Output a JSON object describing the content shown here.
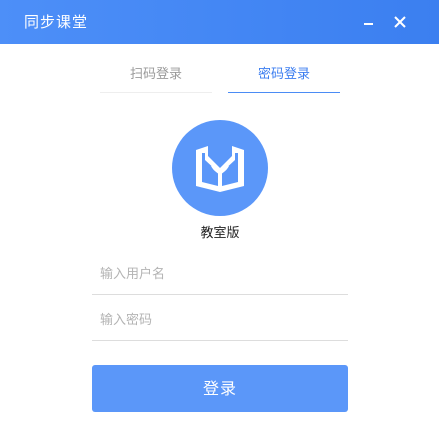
{
  "window": {
    "title": "同步课堂",
    "accent_color": "#3b7ff0",
    "controls": {
      "minimize_icon": "minimize-icon",
      "close_icon": "close-icon"
    }
  },
  "tabs": [
    {
      "label": "扫码登录",
      "active": false
    },
    {
      "label": "密码登录",
      "active": true
    }
  ],
  "logo": {
    "icon": "open-book-sprout-icon",
    "color": "#5b97f9"
  },
  "edition_label": "教室版",
  "form": {
    "username": {
      "value": "",
      "placeholder": "输入用户名"
    },
    "password": {
      "value": "",
      "placeholder": "输入密码"
    },
    "login_label": "登录",
    "login_color": "#5b97f9"
  }
}
